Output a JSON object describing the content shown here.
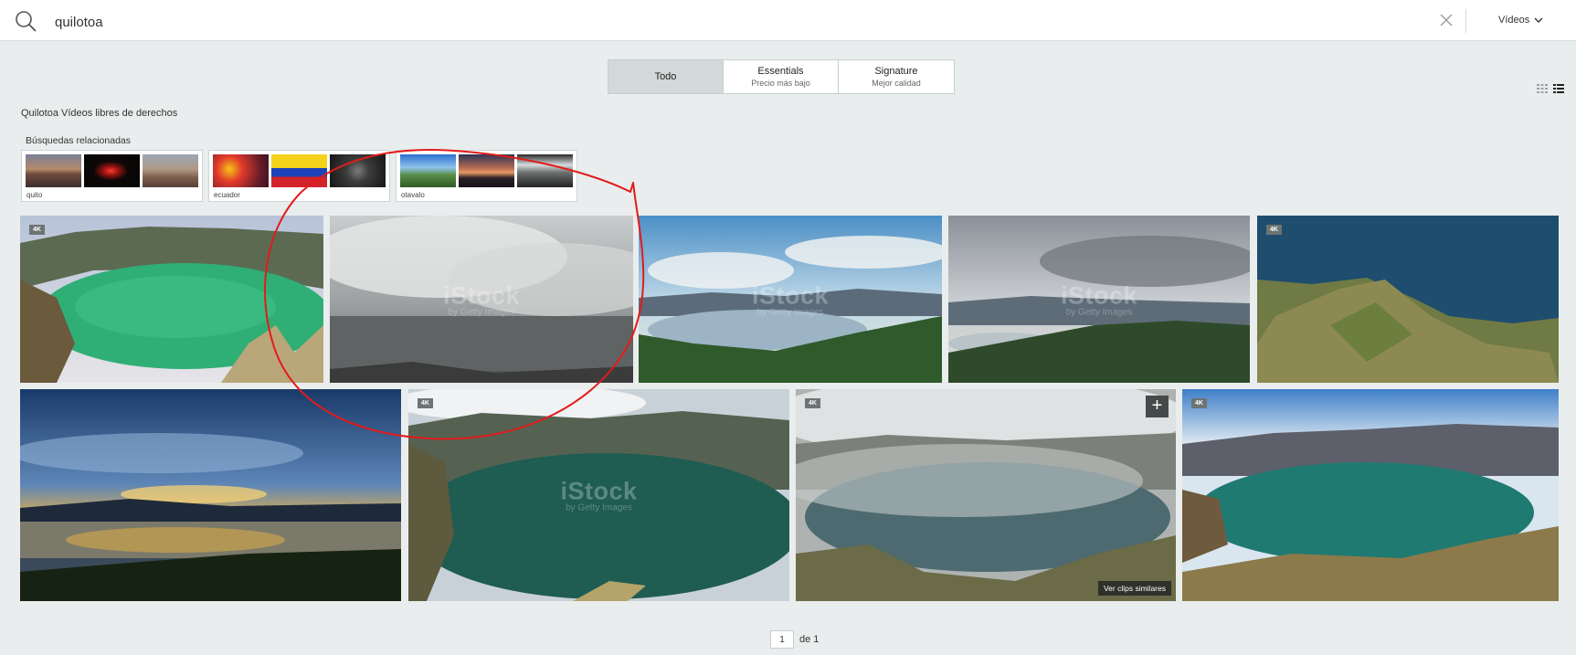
{
  "search": {
    "query": "quilotoa",
    "media_type": "Vídeos"
  },
  "tabs": [
    {
      "label": "Todo",
      "sublabel": ""
    },
    {
      "label": "Essentials",
      "sublabel": "Precio más bajo"
    },
    {
      "label": "Signature",
      "sublabel": "Mejor calidad"
    }
  ],
  "page_heading": "Quilotoa Vídeos libres de derechos",
  "related": {
    "label": "Búsquedas relacionadas",
    "items": [
      {
        "name": "quito"
      },
      {
        "name": "ecuador"
      },
      {
        "name": "otavalo"
      }
    ]
  },
  "badge_4k": "4K",
  "watermark": {
    "main": "iStock",
    "sub": "by Getty Images"
  },
  "add_button": "+",
  "similar_clips": "Ver clips similares",
  "pagination": {
    "current": "1",
    "of_label": "de 1"
  },
  "colors": {
    "background": "#eaeded",
    "active_tab": "#d3d8d8",
    "annotation": "#e21b1b"
  },
  "icons": [
    "search-icon",
    "close-icon",
    "chevron-down-icon",
    "grid-view-icon",
    "list-view-icon"
  ]
}
